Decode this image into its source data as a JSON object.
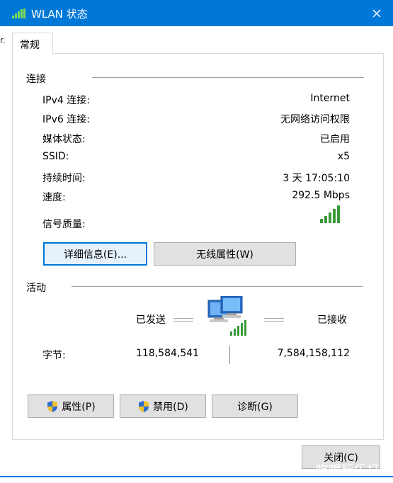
{
  "window": {
    "title": "WLAN 状态",
    "left_edge_text": "r.",
    "accent": "#0078d7"
  },
  "tabs": [
    {
      "label": "常规",
      "active": true
    }
  ],
  "connection": {
    "group_label": "连接",
    "rows": [
      {
        "label": "IPv4 连接:",
        "value": "Internet"
      },
      {
        "label": "IPv6 连接:",
        "value": "无网络访问权限"
      },
      {
        "label": "媒体状态:",
        "value": "已启用"
      },
      {
        "label": "SSID:",
        "value": "x5"
      },
      {
        "label": "持续时间:",
        "value": "3 天 17:05:10"
      },
      {
        "label": "速度:",
        "value": "292.5 Mbps"
      }
    ],
    "signal_label": "信号质量:",
    "signal_bars": 5,
    "details_button": "详细信息(E)...",
    "wireless_props_button": "无线属性(W)"
  },
  "activity": {
    "group_label": "活动",
    "sent_label": "已发送",
    "received_label": "已接收",
    "bytes_label": "字节:",
    "bytes_sent": "118,584,541",
    "bytes_received": "7,584,158,112"
  },
  "actions": {
    "properties_button": "属性(P)",
    "disable_button": "禁用(D)",
    "diagnose_button": "诊断(G)"
  },
  "footer": {
    "close_button": "关闭(C)",
    "watermark_text": "吃喝玩乐打"
  }
}
